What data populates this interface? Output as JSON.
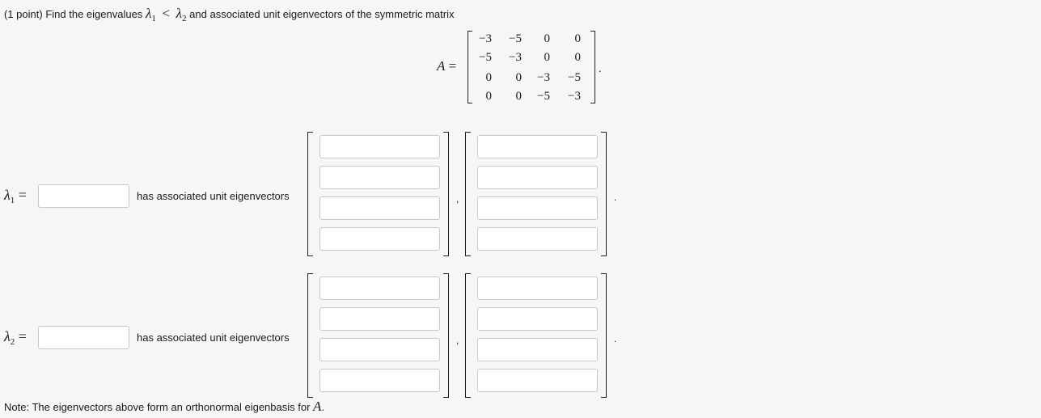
{
  "problem": {
    "points": "(1 point)",
    "text_before": "Find the eigenvalues",
    "lambda_symbol": "λ",
    "sub1": "1",
    "sub2": "2",
    "less_than": "<",
    "text_after": "and associated unit eigenvectors of the symmetric matrix"
  },
  "matrix": {
    "name": "A",
    "equals": "=",
    "rows": [
      [
        "−3",
        "−5",
        "0",
        "0"
      ],
      [
        "−5",
        "−3",
        "0",
        "0"
      ],
      [
        "0",
        "0",
        "−3",
        "−5"
      ],
      [
        "0",
        "0",
        "−5",
        "−3"
      ]
    ],
    "period": "."
  },
  "eigen_rows": [
    {
      "symbol": "λ",
      "sub": "1",
      "equals": "=",
      "value": "",
      "text": "has associated unit eigenvectors",
      "vectors": [
        [
          "",
          "",
          "",
          ""
        ],
        [
          "",
          "",
          "",
          ""
        ]
      ]
    },
    {
      "symbol": "λ",
      "sub": "2",
      "equals": "=",
      "value": "",
      "text": "has associated unit eigenvectors",
      "vectors": [
        [
          "",
          "",
          "",
          ""
        ],
        [
          "",
          "",
          "",
          ""
        ]
      ]
    }
  ],
  "separators": {
    "comma": ",",
    "period": "."
  },
  "note": {
    "text": "Note: The eigenvectors above form an orthonormal eigenbasis for",
    "symbol": "A",
    "end": "."
  }
}
